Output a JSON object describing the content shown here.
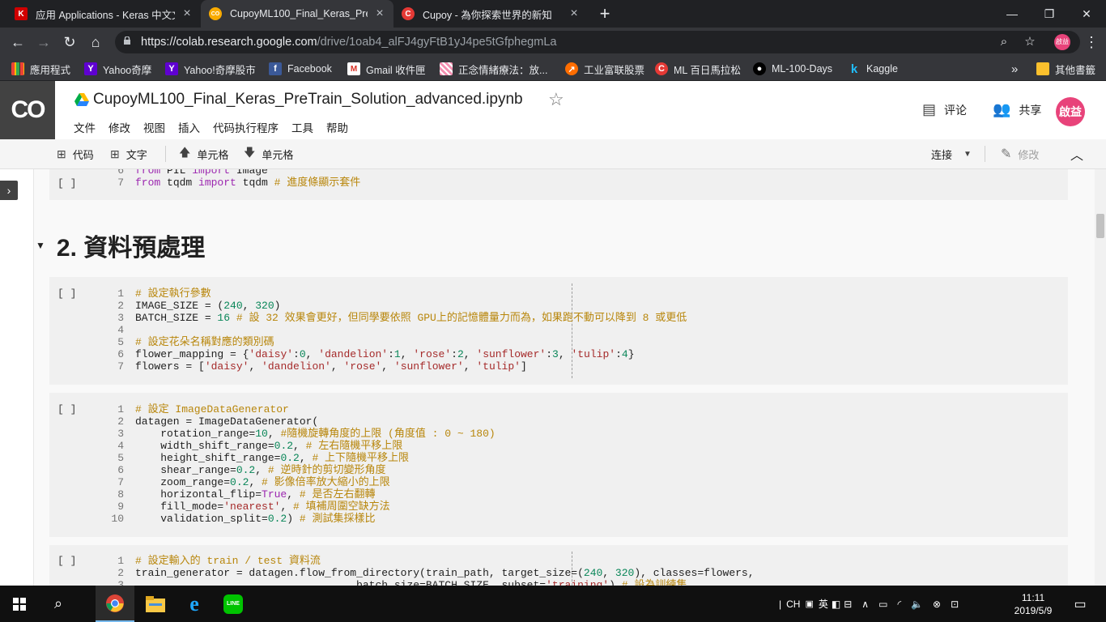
{
  "browser": {
    "tabs": [
      {
        "title": "应用 Applications - Keras 中文文",
        "icon": "keras-icon",
        "color": "#d00000",
        "glyph": "K"
      },
      {
        "title": "CupoyML100_Final_Keras_PreTr",
        "icon": "colab-icon",
        "color": "#f9ab00",
        "glyph": "CO"
      },
      {
        "title": "Cupoy - 為你探索世界的新知",
        "icon": "cupoy-icon",
        "color": "#e53935",
        "glyph": "C"
      }
    ],
    "url_host": "https://colab.research.google.com",
    "url_path": "/drive/1oab4_alFJ4gyFtB1yJ4pe5tGfphegmLa",
    "profile_initials": "啟益",
    "bookmarks": [
      {
        "label": "應用程式",
        "icon": "apps-grid-icon"
      },
      {
        "label": "Yahoo奇摩",
        "icon": "yahoo-icon"
      },
      {
        "label": "Yahoo!奇摩股市",
        "icon": "yahoo-icon"
      },
      {
        "label": "Facebook",
        "icon": "facebook-icon"
      },
      {
        "label": "Gmail 收件匣",
        "icon": "gmail-icon"
      },
      {
        "label": "正念情緒療法：放...",
        "icon": "pattern-icon"
      },
      {
        "label": "工业富联股票",
        "icon": "stock-icon"
      },
      {
        "label": "ML 百日馬拉松",
        "icon": "cupoy-icon"
      },
      {
        "label": "ML-100-Days",
        "icon": "github-icon"
      },
      {
        "label": "Kaggle",
        "icon": "kaggle-icon"
      }
    ],
    "bookmarks_overflow": "»",
    "other_bookmarks": "其他書籤"
  },
  "colab": {
    "logo": "CO",
    "notebook_title": "CupoyML100_Final_Keras_PreTrain_Solution_advanced.ipynb",
    "menu": [
      "文件",
      "修改",
      "视图",
      "插入",
      "代码执行程序",
      "工具",
      "帮助"
    ],
    "comment_label": "评论",
    "share_label": "共享",
    "user_initials": "啟益",
    "toolbar": {
      "add_code": "代码",
      "add_text": "文字",
      "cell_up": "单元格",
      "cell_down": "单元格",
      "connect": "连接",
      "edit": "修改"
    }
  },
  "notebook": {
    "section_heading": "2. 資料預處理",
    "run_indicator": "[ ]"
  },
  "taskbar": {
    "apps": [
      "chrome-icon",
      "file-explorer-icon",
      "ie-icon",
      "line-icon"
    ],
    "ime_lang": "CH",
    "ime_mode": "英",
    "time": "11:11",
    "date": "2019/5/9"
  }
}
